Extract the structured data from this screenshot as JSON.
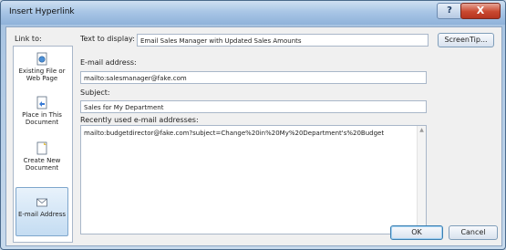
{
  "window": {
    "title": "Insert Hyperlink"
  },
  "titlebar_buttons": {
    "help": "?",
    "close": "X"
  },
  "link_to": {
    "label": "Link to:",
    "items": [
      {
        "label_line1": "Existing File or",
        "label_line2": "Web Page",
        "icon": "globe-file-icon"
      },
      {
        "label_line1": "Place in This",
        "label_line2": "Document",
        "icon": "place-in-document-icon"
      },
      {
        "label_line1": "Create New",
        "label_line2": "Document",
        "icon": "new-document-icon"
      },
      {
        "label_line1": "E-mail Address",
        "label_line2": "",
        "icon": "email-icon"
      }
    ]
  },
  "text_to_display": {
    "label": "Text to display:",
    "value": "Email Sales Manager with Updated Sales Amounts"
  },
  "screentip_button": "ScreenTip...",
  "email_address": {
    "label": "E-mail address:",
    "value": "mailto:salesmanager@fake.com"
  },
  "subject": {
    "label": "Subject:",
    "value": "Sales for My Department"
  },
  "recent": {
    "label": "Recently used e-mail addresses:",
    "items": [
      "mailto:budgetdirector@fake.com?subject=Change%20in%20My%20Department's%20Budget"
    ]
  },
  "buttons": {
    "ok": "OK",
    "cancel": "Cancel"
  }
}
